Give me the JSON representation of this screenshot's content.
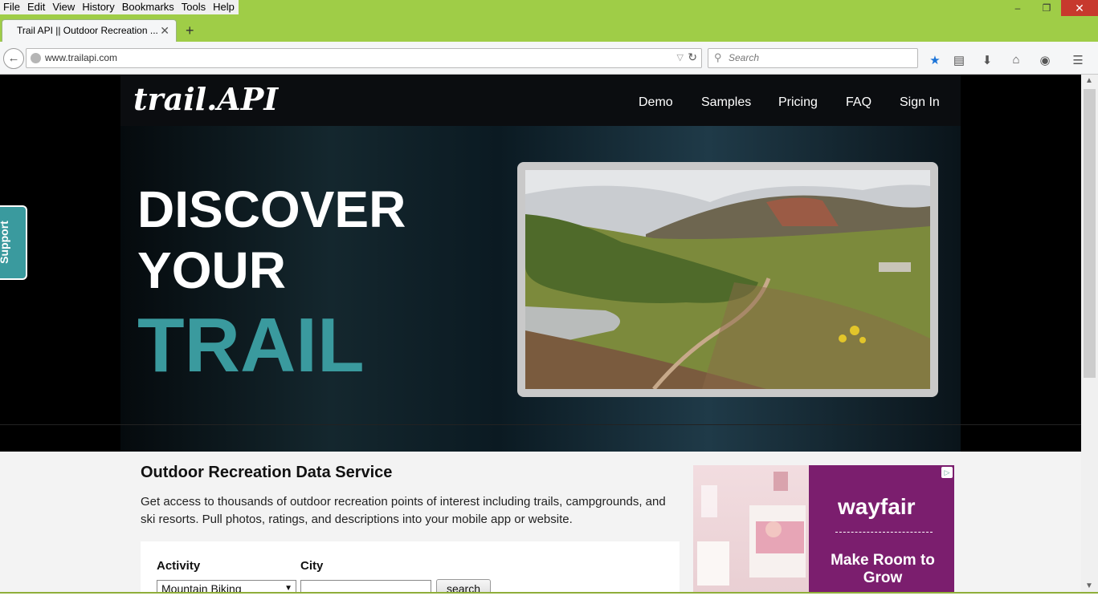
{
  "menu": [
    "File",
    "Edit",
    "View",
    "History",
    "Bookmarks",
    "Tools",
    "Help"
  ],
  "window_controls": {
    "minimize": "–",
    "restore": "❐",
    "close": "✕"
  },
  "tab": {
    "title": "Trail API || Outdoor Recreation ...",
    "close": "✕",
    "new_tab": "+"
  },
  "navbar": {
    "url": "www.trailapi.com",
    "search_placeholder": "Search",
    "icons": [
      "bookmark-star-icon",
      "reading-list-icon",
      "download-icon",
      "home-icon",
      "chat-icon",
      "menu-icon"
    ]
  },
  "site": {
    "logo": "trail.API",
    "nav": [
      "Demo",
      "Samples",
      "Pricing",
      "FAQ",
      "Sign In"
    ],
    "hero": {
      "line1": "DISCOVER",
      "line2": "YOUR",
      "line3": "TRAIL"
    },
    "support_tab": "Support",
    "section": {
      "title": "Outdoor Recreation Data Service",
      "description": "Get access to thousands of outdoor recreation points of interest including trails, campgrounds, and ski resorts. Pull photos, ratings, and descriptions into your mobile app or website."
    },
    "form": {
      "activity_label": "Activity",
      "city_label": "City",
      "activity_value": "Mountain Biking",
      "city_value": "",
      "button": "search"
    },
    "ad": {
      "brand": "wayfair",
      "tagline": "Make Room to Grow"
    }
  },
  "colors": {
    "accent": "#3a9a9e",
    "chrome": "#9fcd47",
    "ad": "#7b1e6e"
  }
}
